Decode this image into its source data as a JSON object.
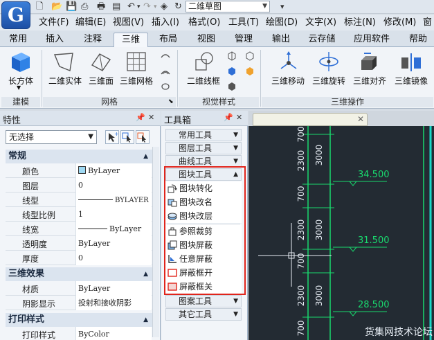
{
  "titlebar": {
    "document_name": "二维草图",
    "menu_arrow": "▾"
  },
  "menubar": {
    "items": [
      "文件(F)",
      "编辑(E)",
      "视图(V)",
      "插入(I)",
      "格式(O)",
      "工具(T)",
      "绘图(D)",
      "文字(X)",
      "标注(N)",
      "修改(M)",
      "窗"
    ]
  },
  "ribbon_tabs": [
    "常用",
    "插入",
    "注释",
    "三维",
    "布局",
    "视图",
    "管理",
    "输出",
    "云存储",
    "应用软件",
    "帮助"
  ],
  "ribbon_active_tab": "三维",
  "ribbon": {
    "buttons": {
      "box": "长方体",
      "solid": "二维实体",
      "surface": "三维面",
      "mesh": "三维网格",
      "wire": "二维线框",
      "move3d": "三维移动",
      "rotate3d": "三维旋转",
      "align3d": "三维对齐",
      "mirror3d": "三维镜像"
    },
    "groups": {
      "model": "建模",
      "mesh": "网格",
      "visual": "视觉样式",
      "ops": "三维操作"
    }
  },
  "properties": {
    "title": "特性",
    "selection": "无选择",
    "sections": {
      "general": "常规",
      "three_d": "三维效果",
      "print": "打印样式"
    },
    "rows": [
      {
        "label": "颜色",
        "value": "ByLayer"
      },
      {
        "label": "图层",
        "value": "0"
      },
      {
        "label": "线型",
        "value": "BYLAYER"
      },
      {
        "label": "线型比例",
        "value": "1"
      },
      {
        "label": "线宽",
        "value": "ByLayer"
      },
      {
        "label": "透明度",
        "value": "ByLayer"
      },
      {
        "label": "厚度",
        "value": "0"
      }
    ],
    "rows3d": [
      {
        "label": "材质",
        "value": "ByLayer"
      },
      {
        "label": "阴影显示",
        "value": "投射和接收阴影"
      }
    ],
    "rows_print": [
      {
        "label": "打印样式",
        "value": "ByColor"
      }
    ]
  },
  "toolbox": {
    "title": "工具箱",
    "groups_top": [
      "常用工具",
      "图层工具",
      "曲线工具",
      "图块工具"
    ],
    "block_tools": [
      "图块转化",
      "图块改名",
      "图块改层",
      "参照裁剪",
      "图块屏蔽",
      "任意屏蔽",
      "屏蔽框开",
      "屏蔽框关"
    ],
    "groups_bottom": [
      "图案工具",
      "其它工具"
    ]
  },
  "drawing": {
    "dims": [
      "3000",
      "2300",
      "700",
      "3000",
      "2300",
      "700",
      "3000",
      "2300",
      "700",
      "700"
    ],
    "levels": [
      "34.500",
      "31.500",
      "28.500"
    ],
    "watermark": "货集网技术论坛"
  }
}
